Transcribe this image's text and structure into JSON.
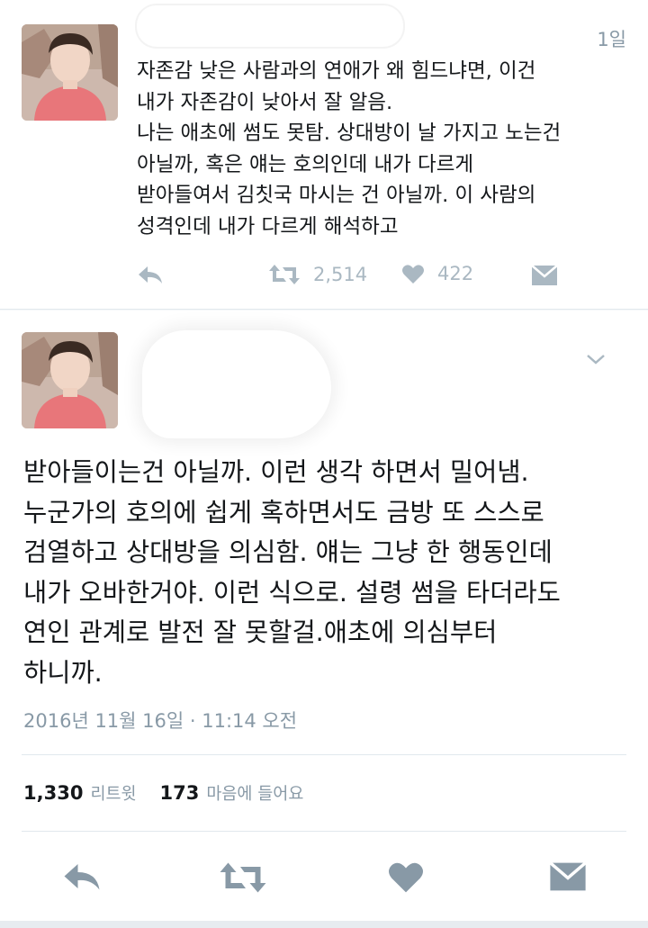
{
  "tweet1": {
    "time": "1일",
    "lines": [
      "자존감 낮은 사람과의 연애가 왜 힘드냐면, 이건",
      "내가 자존감이 낮아서 잘 알음.",
      "나는 애초에 썸도 못탐. 상대방이 날 가지고 노는건",
      "아닐까, 혹은 얘는 호의인데 내가 다르게",
      "받아들여서 김칫국 마시는 건 아닐까. 이 사람의",
      "성격인데 내가 다르게 해석하고"
    ],
    "actions": {
      "reply_icon": "reply-icon",
      "retweet_icon": "retweet-icon",
      "retweet_count": "2,514",
      "like_icon": "heart-icon",
      "like_count": "422",
      "dm_icon": "envelope-icon"
    }
  },
  "tweet2": {
    "lines": [
      "받아들이는건 아닐까. 이런 생각 하면서 밀어냄.",
      "누군가의 호의에 쉽게 혹하면서도 금방 또 스스로",
      "검열하고 상대방을 의심함. 얘는 그냥 한 행동인데",
      "내가 오바한거야. 이런 식으로. 설령 썸을 타더라도",
      "연인 관계로 발전 잘 못할걸.애초에 의심부터",
      "하니까."
    ],
    "timestamp": "2016년 11월 16일 · 11:14 오전",
    "stats": {
      "retweets": "1,330",
      "retweets_label": "리트윗",
      "likes": "173",
      "likes_label": "마음에 들어요"
    }
  },
  "colors": {
    "icon_gray": "#aab8c2",
    "icon_dark": "#8899a6",
    "text": "#14171a",
    "secondary": "#8899a6",
    "background": "#f5f8fa"
  }
}
